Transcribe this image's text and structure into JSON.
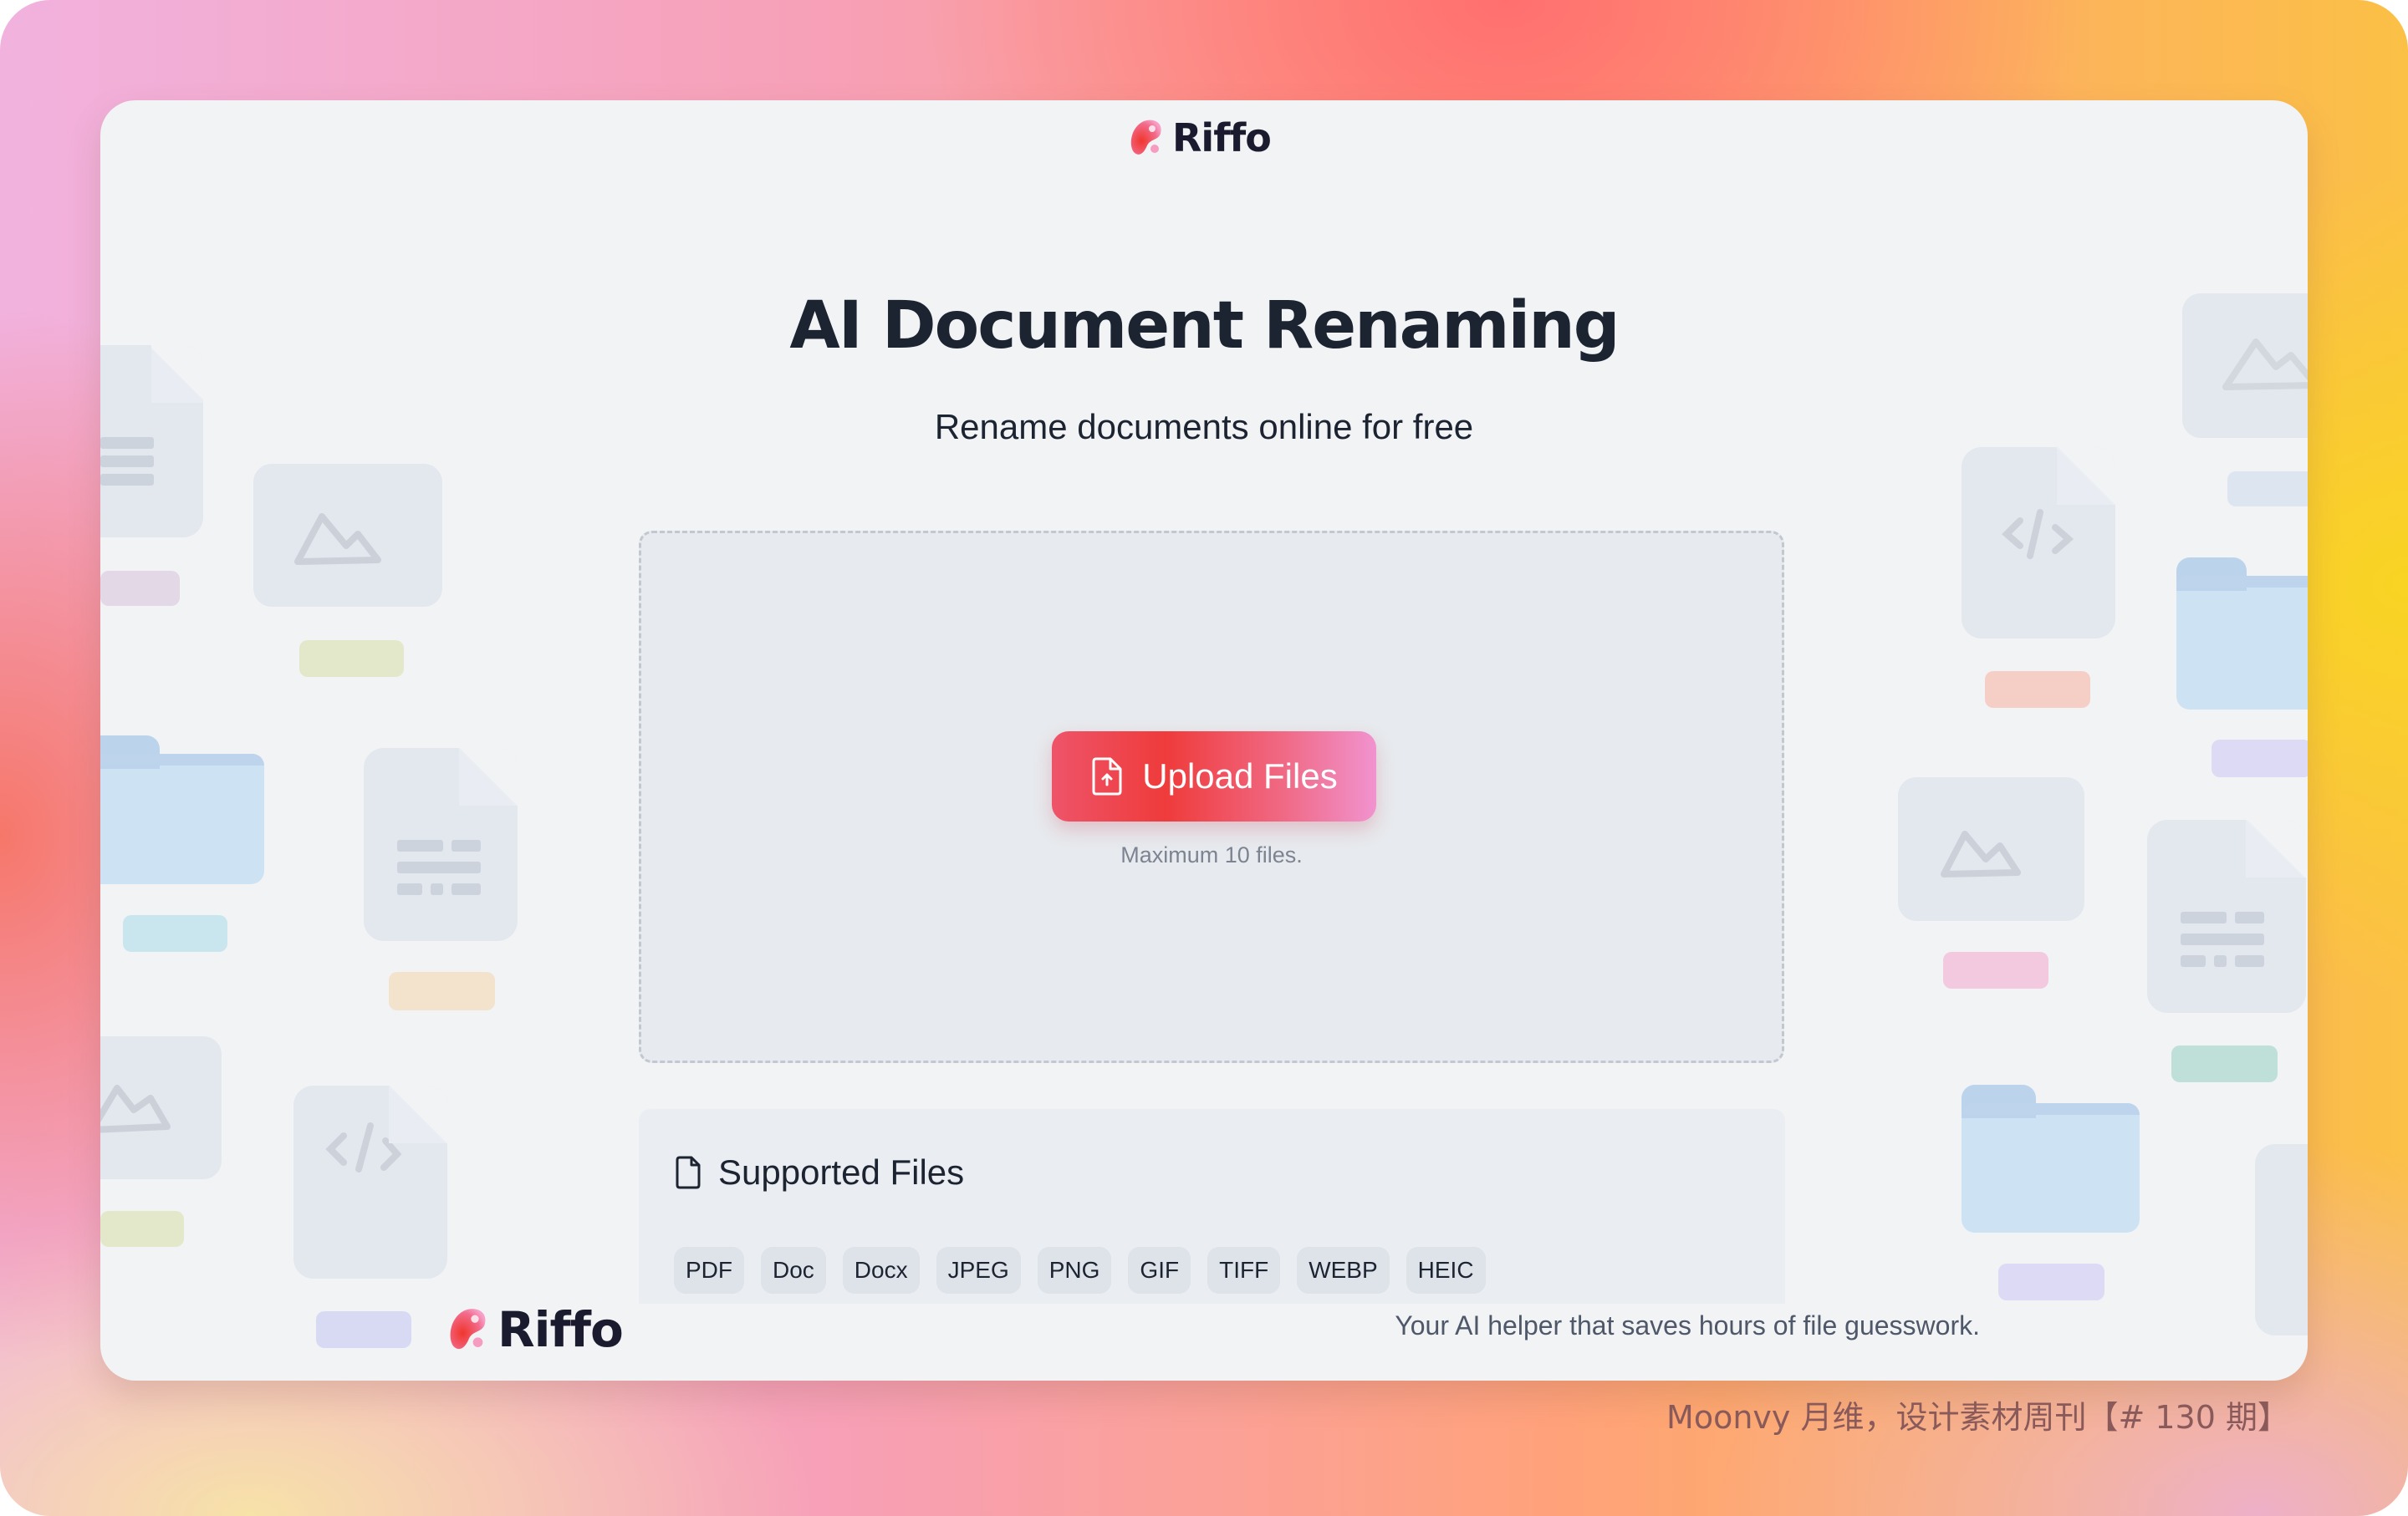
{
  "brand": {
    "name": "Riffo",
    "colors": {
      "accent_start": "#ef3b3b",
      "accent_end": "#f193cf",
      "text_dark": "#1a1b2e"
    }
  },
  "hero": {
    "title": "AI Document Renaming",
    "subtitle": "Rename documents online for free"
  },
  "upload": {
    "button_label": "Upload Files",
    "button_icon": "file-upload-icon",
    "limit_note": "Maximum 10 files."
  },
  "supported": {
    "title": "Supported Files",
    "icon": "file-icon",
    "formats": [
      "PDF",
      "Doc",
      "Docx",
      "JPEG",
      "PNG",
      "GIF",
      "TIFF",
      "WEBP",
      "HEIC"
    ]
  },
  "footer": {
    "brand": "Riffo",
    "tagline": "Your AI helper that saves hours of file guesswork."
  },
  "watermark": "Moonvy 月维，设计素材周刊【# 130 期】",
  "decorations": {
    "left": [
      "text-doc-icon",
      "image-icon",
      "folder-icon",
      "table-doc-icon",
      "image-icon",
      "code-doc-icon"
    ],
    "right": [
      "image-icon",
      "code-doc-icon",
      "folder-icon",
      "image-icon",
      "table-doc-icon",
      "folder-icon",
      "doc-icon"
    ]
  }
}
